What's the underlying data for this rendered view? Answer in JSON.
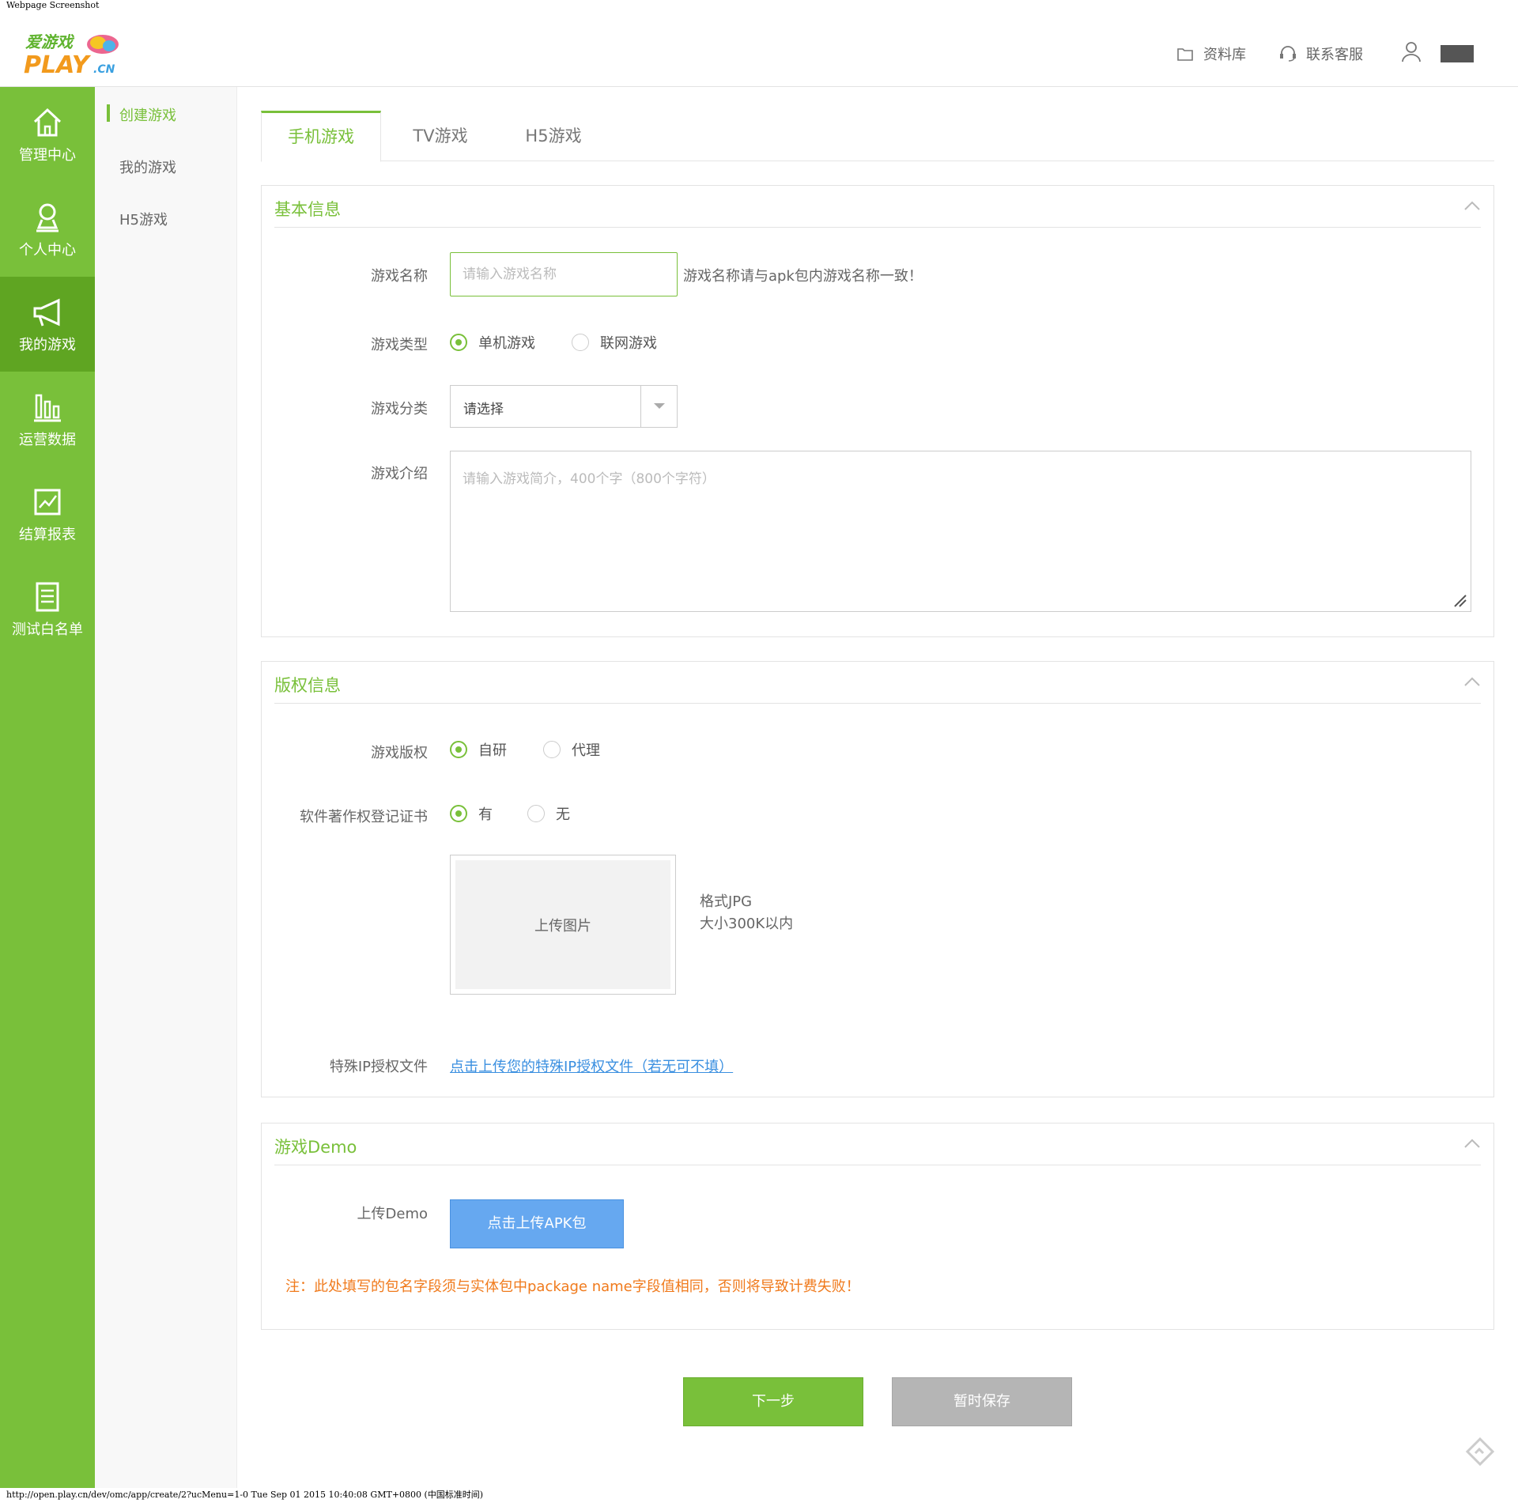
{
  "window": {
    "caption": "Webpage Screenshot",
    "status_url": "http://open.play.cn/dev/omc/app/create/2?ucMenu=1-0 Tue Sep 01 2015 10:40:08 GMT+0800 (中国标准时间)"
  },
  "brand": {
    "logo_top": "爱游戏",
    "logo_bottom": "PLAY",
    "logo_suffix": ".CN",
    "green": "#79c03a"
  },
  "header": {
    "library_label": "资料库",
    "library_icon": "folder-icon",
    "support_label": "联系客服",
    "support_icon": "headset-icon",
    "user_icon": "user-icon"
  },
  "leftnav": {
    "items": [
      {
        "label": "管理中心",
        "icon": "home-icon"
      },
      {
        "label": "个人中心",
        "icon": "person-icon"
      },
      {
        "label": "我的游戏",
        "icon": "megaphone-icon",
        "active": true
      },
      {
        "label": "运营数据",
        "icon": "bar-chart-icon"
      },
      {
        "label": "结算报表",
        "icon": "line-chart-icon"
      },
      {
        "label": "测试白名单",
        "icon": "list-icon"
      }
    ]
  },
  "subnav": {
    "items": [
      {
        "label": "创建游戏",
        "active": true
      },
      {
        "label": "我的游戏"
      },
      {
        "label": "H5游戏"
      }
    ]
  },
  "tabs": [
    {
      "label": "手机游戏",
      "active": true
    },
    {
      "label": "TV游戏"
    },
    {
      "label": "H5游戏"
    }
  ],
  "basic": {
    "title": "基本信息",
    "name_label": "游戏名称",
    "name_placeholder": "请输入游戏名称",
    "name_hint": "游戏名称请与apk包内游戏名称一致！",
    "type_label": "游戏类型",
    "type_options": [
      {
        "label": "单机游戏",
        "selected": true
      },
      {
        "label": "联网游戏",
        "selected": false
      }
    ],
    "category_label": "游戏分类",
    "category_value": "请选择",
    "intro_label": "游戏介绍",
    "intro_placeholder": "请输入游戏简介，400个字（800个字符）"
  },
  "copyright": {
    "title": "版权信息",
    "rights_label": "游戏版权",
    "rights_options": [
      {
        "label": "自研",
        "selected": true
      },
      {
        "label": "代理",
        "selected": false
      }
    ],
    "cert_label": "软件著作权登记证书",
    "cert_options": [
      {
        "label": "有",
        "selected": true
      },
      {
        "label": "无",
        "selected": false
      }
    ],
    "upload_label": "上传图片",
    "format_line1": "格式JPG",
    "format_line2": "大小300K以内",
    "ip_label": "特殊IP授权文件",
    "ip_link": "点击上传您的特殊IP授权文件（若无可不填）"
  },
  "demo": {
    "title": "游戏Demo",
    "upload_label": "上传Demo",
    "upload_button": "点击上传APK包",
    "note": "注：此处填写的包名字段须与实体包中package name字段值相同，否则将导致计费失败！"
  },
  "actions": {
    "next": "下一步",
    "save": "暂时保存"
  }
}
